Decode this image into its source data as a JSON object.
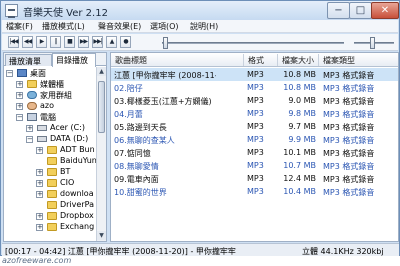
{
  "window": {
    "title": "音樂天使 Ver 2.12",
    "minimize": "−",
    "maximize": "□",
    "close": "✕"
  },
  "menu": [
    "檔案(F)",
    "播放模式(L)",
    "聲音效果(E)",
    "選項(O)",
    "說明(H)"
  ],
  "toolbar": {
    "buttons": [
      {
        "name": "prev-track-button",
        "glyph": "|◀◀"
      },
      {
        "name": "rewind-button",
        "glyph": "◀◀"
      },
      {
        "name": "play-button",
        "glyph": "▶"
      },
      {
        "name": "pause-button",
        "glyph": "||"
      },
      {
        "name": "stop-button",
        "glyph": "■"
      },
      {
        "name": "fast-forward-button",
        "glyph": "▶▶"
      },
      {
        "name": "next-track-button",
        "glyph": "▶▶|"
      },
      {
        "name": "open-button",
        "glyph": "▲"
      },
      {
        "name": "record-button",
        "glyph": "●"
      }
    ]
  },
  "left_tabs": [
    "播放清單",
    "目錄播放"
  ],
  "tree": [
    {
      "label": "桌面",
      "icon": "desk",
      "indent": 0,
      "expander": "−"
    },
    {
      "label": "媒體櫃",
      "icon": "folder",
      "indent": 1,
      "expander": "+"
    },
    {
      "label": "家用群組",
      "icon": "net",
      "indent": 1,
      "expander": "+"
    },
    {
      "label": "azo",
      "icon": "user",
      "indent": 1,
      "expander": "+"
    },
    {
      "label": "電腦",
      "icon": "pc",
      "indent": 1,
      "expander": "−"
    },
    {
      "label": "Acer (C:)",
      "icon": "drive",
      "indent": 2,
      "expander": "+"
    },
    {
      "label": "DATA (D:)",
      "icon": "drive",
      "indent": 2,
      "expander": "−"
    },
    {
      "label": "ADT Bun",
      "icon": "folder",
      "indent": 3,
      "expander": "+"
    },
    {
      "label": "BaiduYun",
      "icon": "folder",
      "indent": 3,
      "expander": ""
    },
    {
      "label": "BT",
      "icon": "folder",
      "indent": 3,
      "expander": "+"
    },
    {
      "label": "CIO",
      "icon": "folder",
      "indent": 3,
      "expander": "+"
    },
    {
      "label": "downloa",
      "icon": "folder",
      "indent": 3,
      "expander": "+"
    },
    {
      "label": "DriverPa",
      "icon": "folder",
      "indent": 3,
      "expander": ""
    },
    {
      "label": "Dropbox",
      "icon": "folder",
      "indent": 3,
      "expander": "+"
    },
    {
      "label": "Exchang",
      "icon": "folder",
      "indent": 3,
      "expander": "+"
    }
  ],
  "table": {
    "headers": [
      "歌曲標題",
      "格式",
      "檔案大小",
      "檔案類型"
    ],
    "rows": [
      {
        "title": "江蕙 [甲你攏牢牢 (2008-11-20)]",
        "format": "MP3",
        "size": "10.8 MB",
        "type": "MP3 格式錄音",
        "selected": true
      },
      {
        "title": "02.陪仔",
        "format": "MP3",
        "size": "10.8 MB",
        "type": "MP3 格式錄音",
        "selected": false
      },
      {
        "title": "03.椰樣菱玉(江蕙+方嫻儀)",
        "format": "MP3",
        "size": "9.0 MB",
        "type": "MP3 格式錄音",
        "selected": false
      },
      {
        "title": "04.月蕾",
        "format": "MP3",
        "size": "9.8 MB",
        "type": "MP3 格式錄音",
        "selected": false
      },
      {
        "title": "05.路邊到天長",
        "format": "MP3",
        "size": "9.7 MB",
        "type": "MP3 格式錄音",
        "selected": false
      },
      {
        "title": "06.無聊的查某人",
        "format": "MP3",
        "size": "9.9 MB",
        "type": "MP3 格式錄音",
        "selected": false
      },
      {
        "title": "07.惦同憶",
        "format": "MP3",
        "size": "10.1 MB",
        "type": "MP3 格式錄音",
        "selected": false
      },
      {
        "title": "08.無聊愛情",
        "format": "MP3",
        "size": "10.7 MB",
        "type": "MP3 格式錄音",
        "selected": false
      },
      {
        "title": "09.電車內面",
        "format": "MP3",
        "size": "12.4 MB",
        "type": "MP3 格式錄音",
        "selected": false
      },
      {
        "title": "10.甜蜜的世界",
        "format": "MP3",
        "size": "10.4 MB",
        "type": "MP3 格式錄音",
        "selected": false
      }
    ]
  },
  "status": {
    "time": "[00:17 - 04:42]   江蕙 [甲你攏牢牢 (2008-11-20)] - 甲你攏牢牢",
    "info": "立體 44.1KHz 320kbj"
  },
  "watermark": "azofreeware.com"
}
